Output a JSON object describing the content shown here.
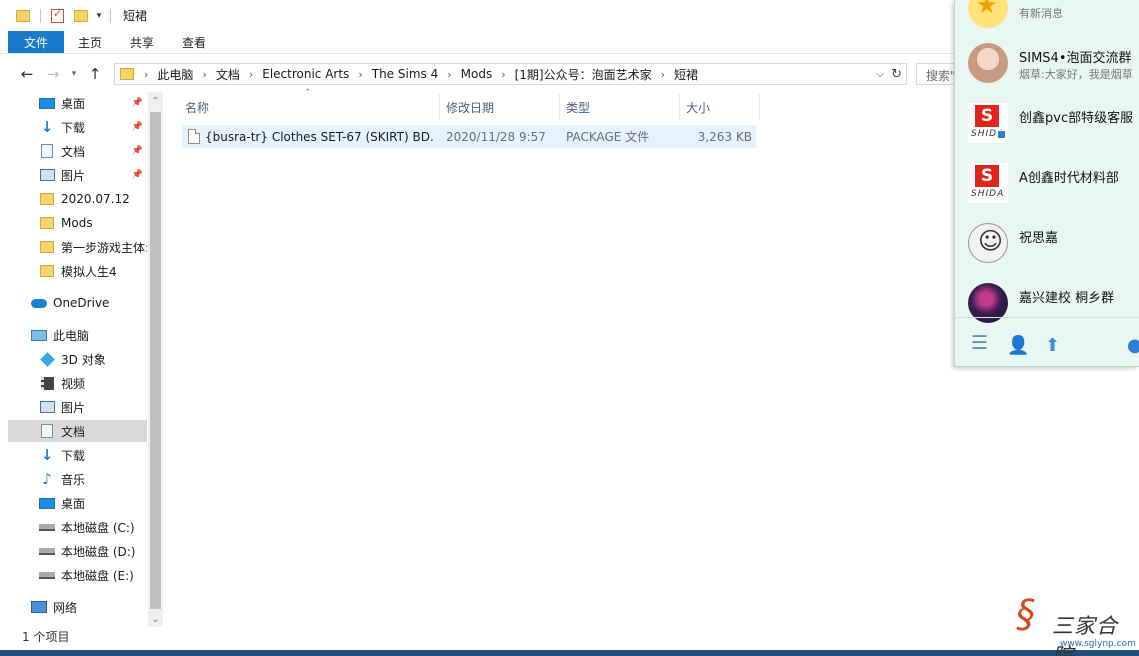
{
  "window": {
    "title": "短裙"
  },
  "ribbon": {
    "tabs": [
      "文件",
      "主页",
      "共享",
      "查看"
    ]
  },
  "address": {
    "crumbs": [
      "此电脑",
      "文档",
      "Electronic Arts",
      "The Sims 4",
      "Mods",
      "[1期]公众号：泡面艺术家",
      "短裙"
    ],
    "search_placeholder": "搜索\"短裙\""
  },
  "nav": {
    "quick_access": [
      {
        "label": "桌面",
        "icon": "desktop-icon",
        "pinned": true
      },
      {
        "label": "下载",
        "icon": "download-icon",
        "pinned": true
      },
      {
        "label": "文档",
        "icon": "document-icon",
        "pinned": true
      },
      {
        "label": "图片",
        "icon": "pictures-icon",
        "pinned": true
      },
      {
        "label": "2020.07.12",
        "icon": "folder-icon",
        "pinned": false
      },
      {
        "label": "Mods",
        "icon": "folder-icon",
        "pinned": false
      },
      {
        "label": "第一步游戏主体:",
        "icon": "folder-icon",
        "pinned": false
      },
      {
        "label": "模拟人生4",
        "icon": "folder-icon",
        "pinned": false
      }
    ],
    "onedrive": "OneDrive",
    "this_pc": "此电脑",
    "pc_items": [
      {
        "label": "3D 对象",
        "icon": "3d-objects-icon"
      },
      {
        "label": "视频",
        "icon": "video-icon"
      },
      {
        "label": "图片",
        "icon": "pictures-icon"
      },
      {
        "label": "文档",
        "icon": "document-icon",
        "selected": true
      },
      {
        "label": "下载",
        "icon": "download-icon"
      },
      {
        "label": "音乐",
        "icon": "music-icon"
      },
      {
        "label": "桌面",
        "icon": "desktop-icon"
      },
      {
        "label": "本地磁盘 (C:)",
        "icon": "disk-icon"
      },
      {
        "label": "本地磁盘 (D:)",
        "icon": "disk-icon"
      },
      {
        "label": "本地磁盘 (E:)",
        "icon": "disk-icon"
      }
    ],
    "network": "网络"
  },
  "columns": {
    "name": "名称",
    "date": "修改日期",
    "type": "类型",
    "size": "大小"
  },
  "files": [
    {
      "name": "{busra-tr} Clothes SET-67 (SKIRT) BD...",
      "date": "2020/11/28 9:57",
      "type": "PACKAGE 文件",
      "size": "3,263 KB"
    }
  ],
  "status": {
    "count": "1 个项目"
  },
  "chat": {
    "contacts": [
      {
        "name": "",
        "message": "有新消息",
        "avatar": "star-avatar"
      },
      {
        "name": "SIMS4•泡面交流群",
        "message": "烟草:大家好，我是烟草",
        "avatar": "girl-avatar"
      },
      {
        "name": "创鑫pvc部特级客服",
        "message": "",
        "avatar": "s-logo-avatar"
      },
      {
        "name": "A创鑫时代材料部",
        "message": "",
        "avatar": "s-logo-avatar"
      },
      {
        "name": "祝思嘉",
        "message": "",
        "avatar": "cartoon-avatar"
      },
      {
        "name": "嘉兴建校  桐乡群",
        "message": "",
        "avatar": "night-avatar"
      }
    ],
    "logo_text": "SHIDA"
  },
  "watermark": {
    "text": "三家合院",
    "url": "www.sglynp.com"
  }
}
